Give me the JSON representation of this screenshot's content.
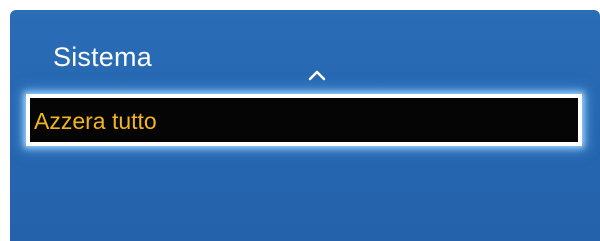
{
  "panel": {
    "title": "Sistema",
    "background_color": "#2566b0",
    "up_arrow_icon": "chevron-up-icon"
  },
  "menu": {
    "items": [
      {
        "label": "Azzera tutto",
        "selected": true,
        "label_color": "#f2b51b",
        "background_color": "#050505"
      }
    ]
  }
}
